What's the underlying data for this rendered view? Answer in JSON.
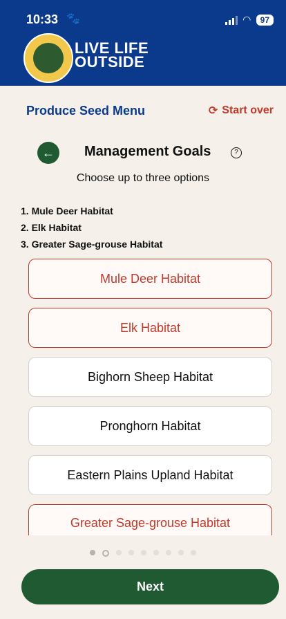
{
  "status_bar": {
    "time": "10:33",
    "battery": "97"
  },
  "header": {
    "brand_line1": "LIVE LIFE",
    "brand_line2": "OUTSIDE",
    "logo_text": "COLORADO PARKS & WILDLIFE"
  },
  "nav": {
    "menu_title": "Produce Seed Menu",
    "start_over": "Start over",
    "start_over_icon": "refresh-icon"
  },
  "page": {
    "title": "Management Goals",
    "help_icon": "help-circle-icon",
    "back_icon": "arrow-left-icon",
    "subtitle": "Choose up to three options"
  },
  "selected": [
    "1. Mule Deer Habitat",
    "2. Elk Habitat",
    "3. Greater Sage-grouse Habitat"
  ],
  "options": [
    {
      "label": "Mule Deer Habitat",
      "selected": true
    },
    {
      "label": "Elk Habitat",
      "selected": true
    },
    {
      "label": "Bighorn Sheep Habitat",
      "selected": false
    },
    {
      "label": "Pronghorn Habitat",
      "selected": false
    },
    {
      "label": "Eastern Plains Upland Habitat",
      "selected": false
    },
    {
      "label": "Greater Sage-grouse Habitat",
      "selected": true
    }
  ],
  "pagination": {
    "current_index": 2,
    "total": 9
  },
  "footer": {
    "next_label": "Next"
  },
  "colors": {
    "header": "#0b3a8c",
    "accent_red": "#c0392b",
    "primary_green": "#1f5a33",
    "background": "#f5f1ea"
  }
}
